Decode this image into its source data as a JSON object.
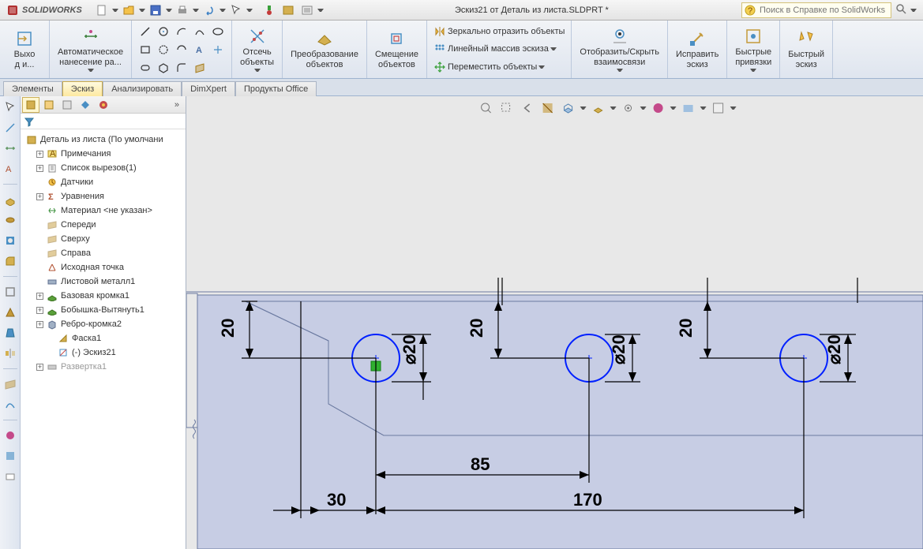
{
  "title": {
    "app": "SOLIDWORKS",
    "doc": "Эскиз21 от Деталь из листа.SLDPRT *",
    "search_placeholder": "Поиск в Справке по SolidWorks"
  },
  "ribbon": {
    "exit": "Выхо\nд и...",
    "autodim": "Автоматическое\nнанесение ра...",
    "trim": "Отсечь\nобъекты",
    "convert": "Преобразование\nобъектов",
    "offset": "Смещение\nобъектов",
    "mirror": "Зеркально отразить объекты",
    "linpattern": "Линейный массив эскиза",
    "move": "Переместить объекты",
    "showrel": "Отобразить/Скрыть\nвзаимосвязи",
    "fix": "Исправить\nэскиз",
    "quicksnap": "Быстрые\nпривязки",
    "quicksketch": "Быстрый\nэскиз"
  },
  "tabs": {
    "t1": "Элементы",
    "t2": "Эскиз",
    "t3": "Анализировать",
    "t4": "DimXpert",
    "t5": "Продукты Office"
  },
  "tree": {
    "root": "Деталь из листа  (По умолчани",
    "items": [
      "Примечания",
      "Список вырезов(1)",
      "Датчики",
      "Уравнения",
      "Материал <не указан>",
      "Спереди",
      "Сверху",
      "Справа",
      "Исходная точка",
      "Листовой металл1",
      "Базовая кромка1",
      "Бобышка-Вытянуть1",
      "Ребро-кромка2",
      "Фаска1",
      "(-) Эскиз21",
      "Развертка1"
    ]
  },
  "dims": {
    "d20a": "20",
    "d20b": "20",
    "d20c": "20",
    "dia20a": "⌀20",
    "dia20b": "⌀20",
    "dia20c": "⌀20",
    "d85": "85",
    "d170": "170",
    "d30": "30"
  }
}
